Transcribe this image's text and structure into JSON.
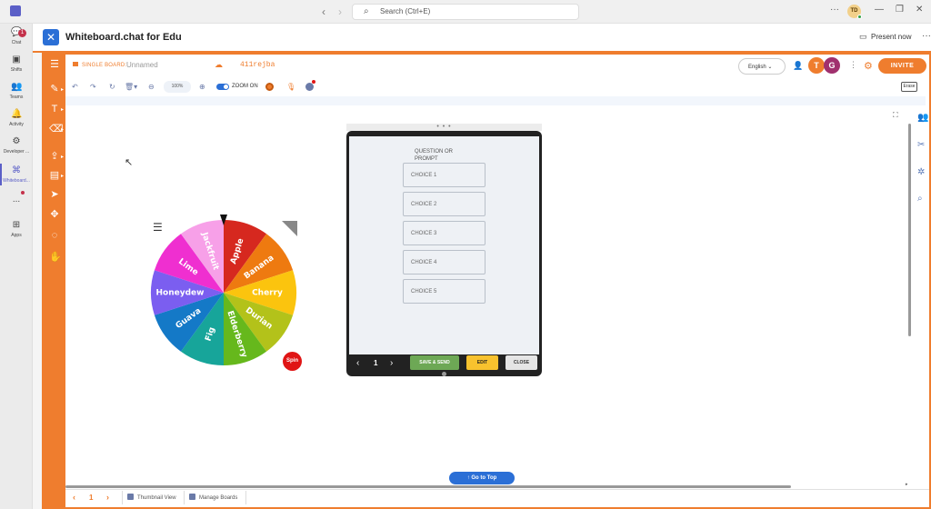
{
  "titlebar": {
    "search_placeholder": "Search (Ctrl+E)",
    "user_initials": "TD"
  },
  "rail": {
    "items": [
      {
        "label": "Chat",
        "badge": "1",
        "icon": "chat-icon"
      },
      {
        "label": "Shifts",
        "icon": "shifts-icon"
      },
      {
        "label": "Teams",
        "icon": "teams-icon"
      },
      {
        "label": "Activity",
        "icon": "bell-icon"
      },
      {
        "label": "Developer ...",
        "icon": "developer-icon"
      },
      {
        "label": "Whiteboard...",
        "icon": "whiteboard-icon",
        "active": true
      },
      {
        "label": "...",
        "icon": "more-icon"
      },
      {
        "label": "Apps",
        "icon": "apps-icon"
      }
    ]
  },
  "app": {
    "title": "Whiteboard.chat for Edu",
    "present_label": "Present now"
  },
  "board": {
    "type_label": "SINGLE BOARD:",
    "name": "Unnamed",
    "code": "411rejba",
    "language": "English",
    "avatars": [
      "T",
      "G"
    ],
    "invite_label": "INVITE",
    "zoom_level": "100%",
    "zoom_toggle_label": "ZOOM ON",
    "erase_label": "Erase"
  },
  "wheel": {
    "segments": [
      "Apple",
      "Banana",
      "Cherry",
      "Durian",
      "Elderberry",
      "Fig",
      "Guava",
      "Honeydew",
      "Lime",
      "Jackfruit"
    ],
    "colors": [
      "#d6281f",
      "#ee7a10",
      "#fbc40e",
      "#b3c21a",
      "#66b81c",
      "#17a59a",
      "#1479c7",
      "#7b5ef0",
      "#ef2fd0",
      "#f7a0e8"
    ],
    "spin_label": "Spin"
  },
  "question_card": {
    "prompt": "QUESTION OR PROMPT",
    "choices": [
      "CHOICE 1",
      "CHOICE 2",
      "CHOICE 3",
      "CHOICE 4",
      "CHOICE 5"
    ],
    "page": "1",
    "save_label": "SAVE & SEND",
    "edit_label": "EDIT",
    "close_label": "CLOSE"
  },
  "footer": {
    "page": "1",
    "thumbnail_label": "Thumbnail View",
    "manage_label": "Manage Boards",
    "go_to_top_label": "Go to Top"
  }
}
